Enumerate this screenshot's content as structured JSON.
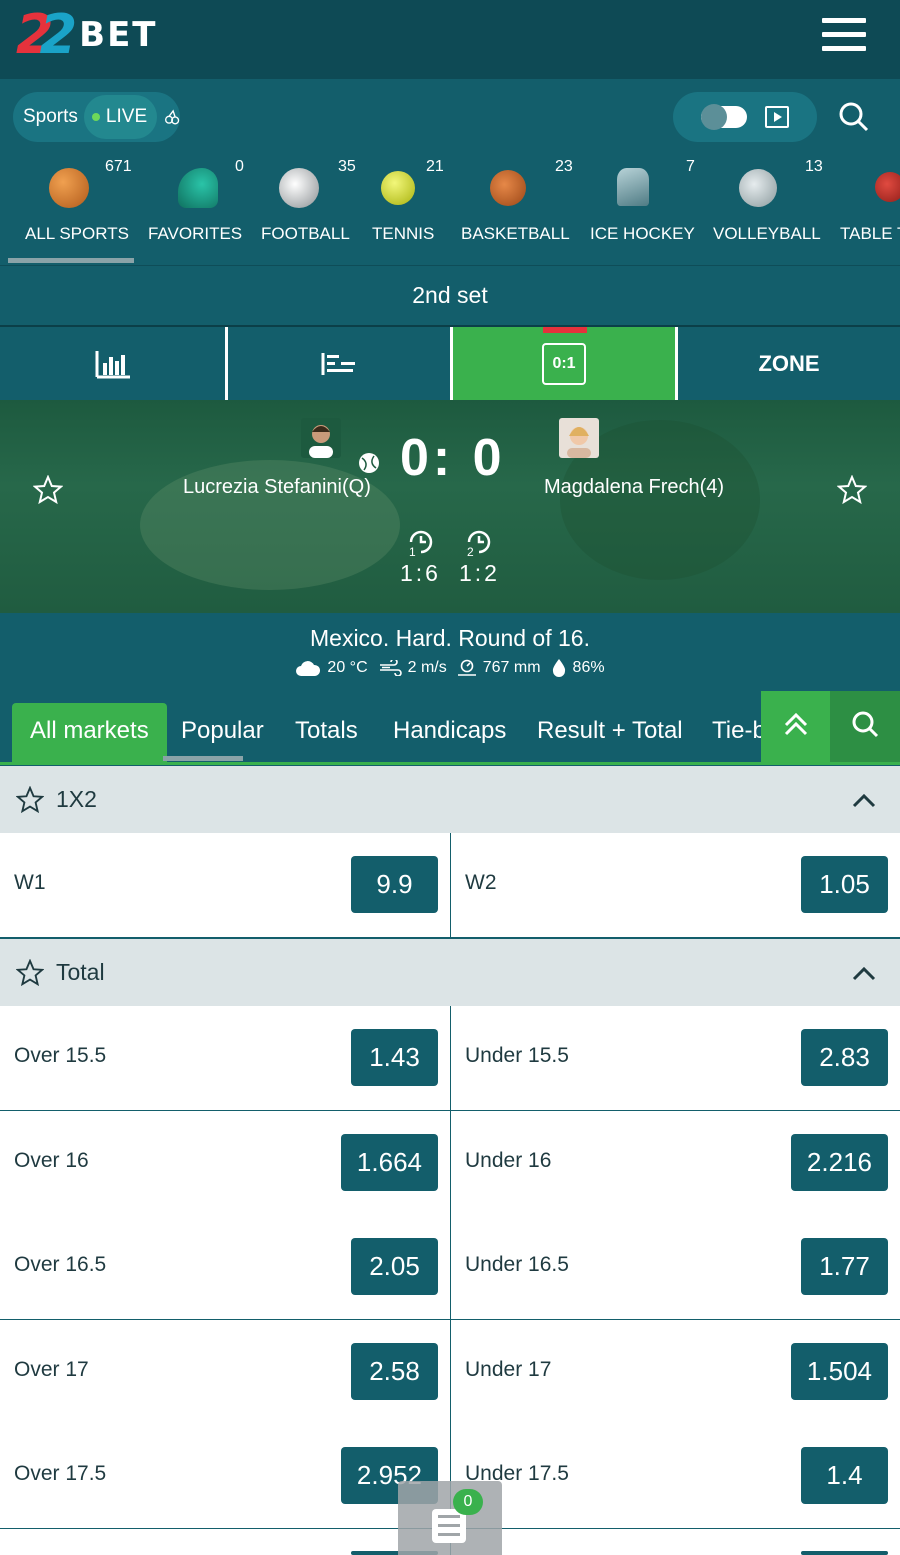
{
  "header": {
    "logo_num_1": "2",
    "logo_num_2": "2",
    "logo_text": "BET"
  },
  "mode": {
    "sports_label": "Sports",
    "live_label": "LIVE"
  },
  "sports": [
    {
      "label": "ALL SPORTS",
      "count": "671",
      "icon": "all-sports-icon",
      "color": "#e07a2e"
    },
    {
      "label": "FAVORITES",
      "count": "0",
      "icon": "favorites-icon",
      "color": "#1a9f8a"
    },
    {
      "label": "FOOTBALL",
      "count": "35",
      "icon": "football-icon",
      "color": "#d8d8d8"
    },
    {
      "label": "TENNIS",
      "count": "21",
      "icon": "tennis-ball-icon",
      "color": "#d7e01d"
    },
    {
      "label": "BASKETBALL",
      "count": "23",
      "icon": "basketball-icon",
      "color": "#c8602a"
    },
    {
      "label": "ICE HOCKEY",
      "count": "7",
      "icon": "ice-hockey-icon",
      "color": "#7fa9b0"
    },
    {
      "label": "VOLLEYBALL",
      "count": "13",
      "icon": "volleyball-icon",
      "color": "#b9c5c8"
    },
    {
      "label": "TABLE T",
      "count": "",
      "icon": "table-tennis-icon",
      "color": "#c9302c"
    }
  ],
  "period": "2nd set",
  "view_tabs": {
    "score_box": "0:1",
    "zone": "ZONE"
  },
  "match": {
    "player1": "Lucrezia Stefanini(Q)",
    "player2": "Magdalena Frech(4)",
    "score": "0: 0",
    "set1_num": "1",
    "set2_num": "2",
    "set1_score": "1:6",
    "set2_score": "1:2"
  },
  "tournament": {
    "name": "Mexico. Hard. Round of 16.",
    "temperature": "20 °C",
    "wind": "2 m/s",
    "pressure": "767 mm",
    "humidity": "86%"
  },
  "market_tabs": [
    "All markets",
    "Popular",
    "Totals",
    "Handicaps",
    "Result + Total",
    "Tie-b"
  ],
  "groups": {
    "g1": "1X2",
    "g2": "Total"
  },
  "rows_1x2": [
    {
      "left_label": "W1",
      "left_odd": "9.9",
      "right_label": "W2",
      "right_odd": "1.05"
    }
  ],
  "rows_total": [
    {
      "left_label": "Over 15.5",
      "left_odd": "1.43",
      "right_label": "Under 15.5",
      "right_odd": "2.83"
    },
    {
      "left_label": "Over 16",
      "left_odd": "1.664",
      "right_label": "Under 16",
      "right_odd": "2.216"
    },
    {
      "left_label": "Over 16.5",
      "left_odd": "2.05",
      "right_label": "Under 16.5",
      "right_odd": "1.77"
    },
    {
      "left_label": "Over 17",
      "left_odd": "2.58",
      "right_label": "Under 17",
      "right_odd": "1.504"
    },
    {
      "left_label": "Over 17.5",
      "left_odd": "2.952",
      "right_label": "Under 17.5",
      "right_odd": "1.4"
    }
  ],
  "betslip": {
    "count": "0"
  }
}
